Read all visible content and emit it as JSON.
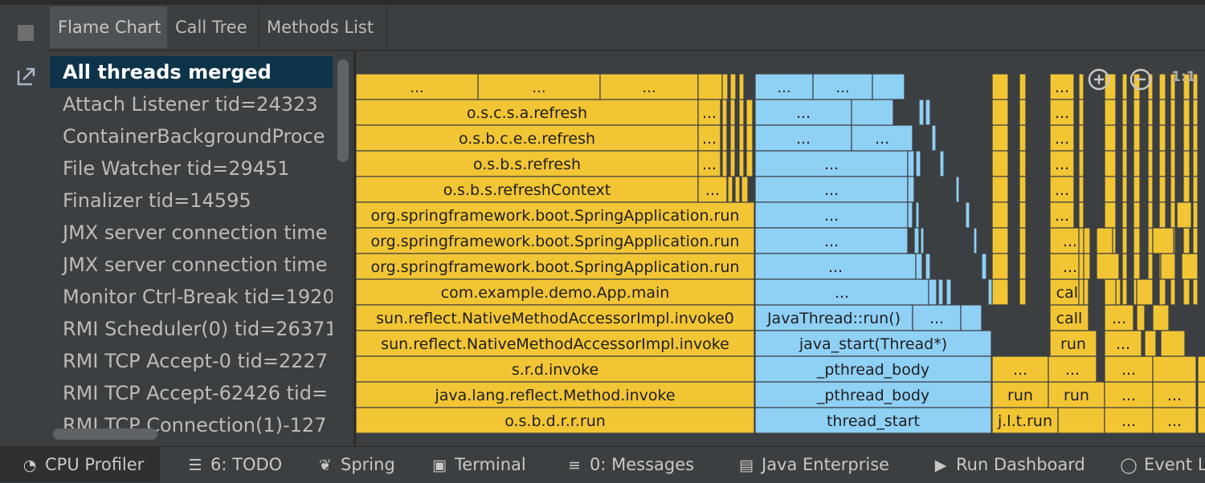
{
  "tabs": [
    {
      "label": "Flame Chart",
      "active": true
    },
    {
      "label": "Call Tree",
      "active": false
    },
    {
      "label": "Methods List",
      "active": false
    }
  ],
  "threads": [
    "All threads merged",
    "Attach Listener tid=24323",
    "ContainerBackgroundProce",
    "File Watcher tid=29451",
    "Finalizer tid=14595",
    "JMX server connection time",
    "JMX server connection time",
    "Monitor Ctrl-Break tid=1920",
    "RMI Scheduler(0) tid=26371",
    "RMI TCP Accept-0 tid=2227",
    "RMI TCP Accept-62426 tid=",
    "RMI TCP Connection(1)-127"
  ],
  "toolbar": {
    "one_to_one": "1:1"
  },
  "colors": {
    "java_frame": "#f2c534",
    "native_frame": "#8fd0f5",
    "background": "#3c3f41",
    "selected_thread": "#0d3349"
  },
  "flame": {
    "yellow_stack": [
      "o.s.c.s.a.refresh",
      "o.s.b.c.e.e.refresh",
      "o.s.b.s.refresh",
      "o.s.b.s.refreshContext",
      "org.springframework.boot.SpringApplication.run",
      "org.springframework.boot.SpringApplication.run",
      "org.springframework.boot.SpringApplication.run",
      "com.example.demo.App.main",
      "sun.reflect.NativeMethodAccessorImpl.invoke0",
      "sun.reflect.NativeMethodAccessorImpl.invoke",
      "s.r.d.invoke",
      "java.lang.reflect.Method.invoke",
      "o.s.b.d.r.r.run"
    ],
    "blue_stack": [
      "...",
      "...",
      "...",
      "...",
      "...",
      "...",
      "...",
      "...",
      "JavaThread::run()",
      "java_start(Thread*)",
      "_pthread_body",
      "_pthread_body",
      "thread_start"
    ],
    "ellipsis": "...",
    "call": "call",
    "run": "run",
    "thread_run": "j.l.t.run"
  },
  "status_bar": [
    {
      "label": "CPU Profiler",
      "icon": "cpu-profiler-icon",
      "active": true
    },
    {
      "label": "6: TODO",
      "icon": "todo-icon",
      "active": false
    },
    {
      "label": "Spring",
      "icon": "spring-leaf-icon",
      "active": false
    },
    {
      "label": "Terminal",
      "icon": "terminal-icon",
      "active": false
    },
    {
      "label": "0: Messages",
      "icon": "messages-icon",
      "active": false
    },
    {
      "label": "Java Enterprise",
      "icon": "java-enterprise-icon",
      "active": false
    },
    {
      "label": "Run Dashboard",
      "icon": "run-icon",
      "active": false
    },
    {
      "label": "Event L",
      "icon": "event-log-icon",
      "active": false
    }
  ]
}
